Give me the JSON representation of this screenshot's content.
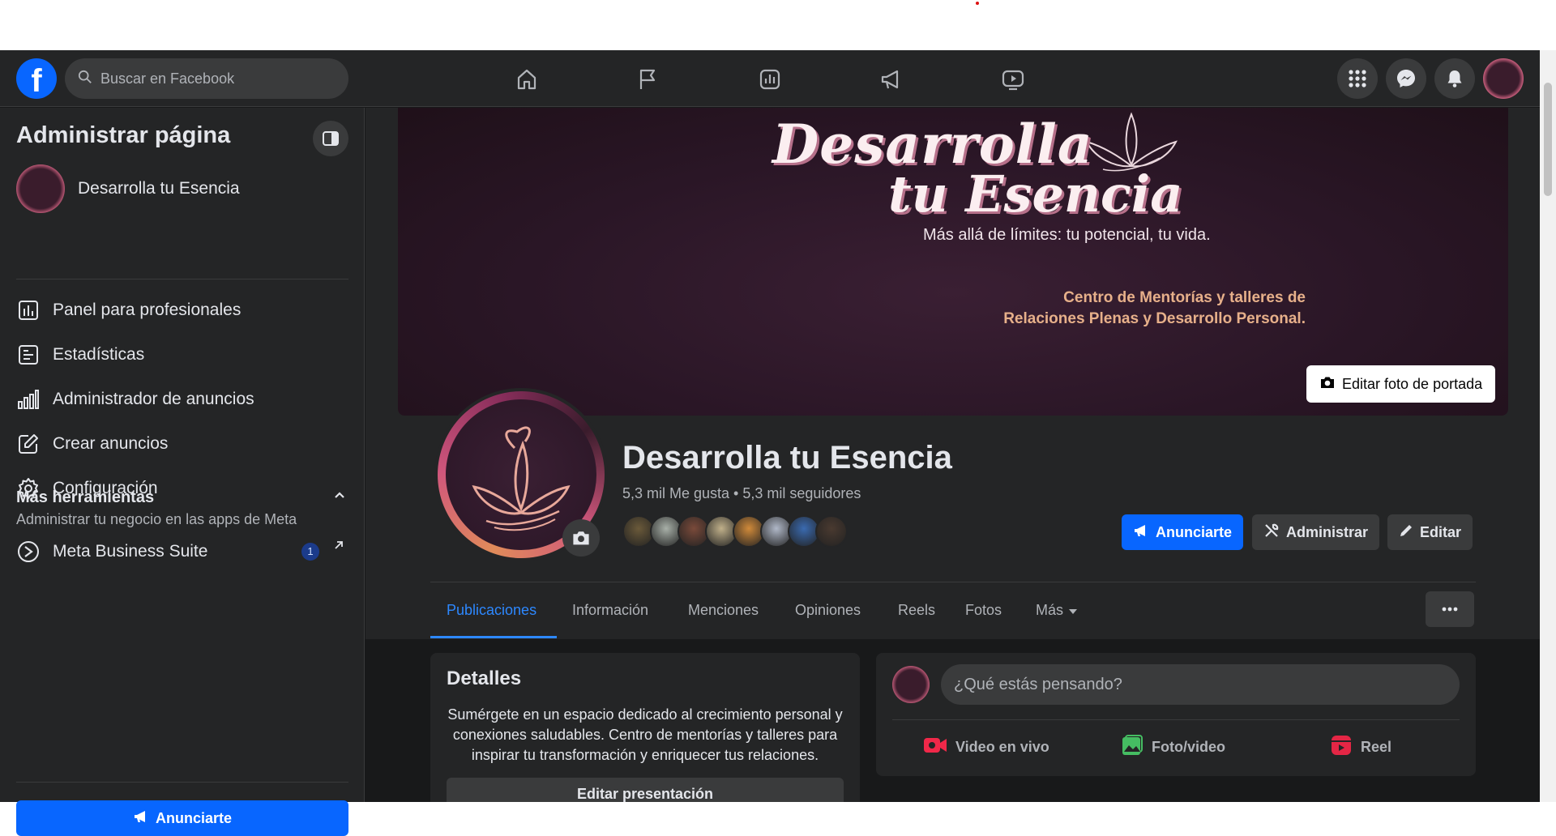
{
  "header": {
    "logo": "f",
    "search_placeholder": "Buscar en Facebook",
    "nav_icons": [
      "home-icon",
      "flag-icon",
      "insights-icon",
      "megaphone-icon",
      "video-icon"
    ],
    "right_icons": [
      "menu-grid-icon",
      "messenger-icon",
      "bell-icon"
    ]
  },
  "sidebar": {
    "title": "Administrar página",
    "page_name": "Desarrolla tu Esencia",
    "items": [
      {
        "label": "Panel para profesionales",
        "icon": "dashboard-icon"
      },
      {
        "label": "Estadísticas",
        "icon": "stats-icon"
      },
      {
        "label": "Administrador de anuncios",
        "icon": "bar-chart-icon"
      },
      {
        "label": "Crear anuncios",
        "icon": "edit-icon"
      },
      {
        "label": "Configuración",
        "icon": "gear-icon"
      }
    ],
    "more_tools_title": "Más herramientas",
    "more_tools_subtitle": "Administrar tu negocio en las apps de Meta",
    "meta_business": "Meta Business Suite",
    "meta_badge": "1",
    "cta": "Anunciarte"
  },
  "cover": {
    "line1": "Desarrolla",
    "line2": "tu Esencia",
    "tagline": "Más allá de límites: tu potencial, tu vida.",
    "desc1": "Centro de Mentorías y talleres de",
    "desc2": "Relaciones Plenas y Desarrollo Personal.",
    "edit_label": "Editar foto de portada"
  },
  "page": {
    "name": "Desarrolla tu Esencia",
    "stats": "5,3 mil Me gusta • 5,3 mil seguidores",
    "follower_colors": [
      "#6b5a3a",
      "#a8b0a8",
      "#7a4a3a",
      "#c0b08a",
      "#d08a3a",
      "#b0b8c8",
      "#3a6ab0",
      "#4a3a30"
    ]
  },
  "actions": {
    "advertise": "Anunciarte",
    "manage": "Administrar",
    "edit": "Editar"
  },
  "tabs": [
    "Publicaciones",
    "Información",
    "Menciones",
    "Opiniones",
    "Reels",
    "Fotos",
    "Más"
  ],
  "details": {
    "title": "Detalles",
    "text": "Sumérgete en un espacio dedicado al crecimiento personal y conexiones saludables. Centro de mentorías y talleres para inspirar tu transformación y enriquecer tus relaciones.",
    "button": "Editar presentación"
  },
  "composer": {
    "placeholder": "¿Qué estás pensando?",
    "live": "Video en vivo",
    "photo": "Foto/video",
    "reel": "Reel"
  },
  "colors": {
    "accent": "#0866ff",
    "bg": "#18191a",
    "surface": "#242526",
    "live": "#f02849",
    "photo": "#45bd62",
    "reel": "#e42645"
  }
}
